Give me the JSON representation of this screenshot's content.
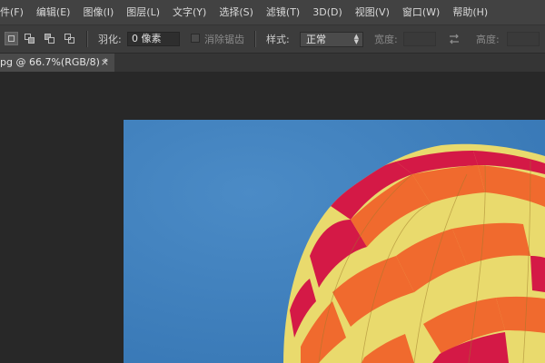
{
  "menubar": {
    "items": [
      {
        "label": "件(F)"
      },
      {
        "label": "编辑(E)"
      },
      {
        "label": "图像(I)"
      },
      {
        "label": "图层(L)"
      },
      {
        "label": "文字(Y)"
      },
      {
        "label": "选择(S)"
      },
      {
        "label": "滤镜(T)"
      },
      {
        "label": "3D(D)"
      },
      {
        "label": "视图(V)"
      },
      {
        "label": "窗口(W)"
      },
      {
        "label": "帮助(H)"
      }
    ]
  },
  "options": {
    "feather_label": "羽化:",
    "feather_value": "0 像素",
    "antialias_label": "消除锯齿",
    "style_label": "样式:",
    "style_value": "正常",
    "width_label": "宽度:",
    "height_label": "高度:"
  },
  "document": {
    "tab_title": "pg @ 66.7%(RGB/8) *",
    "close_glyph": "×"
  },
  "colors": {
    "sky": "#3d7fbd",
    "balloon_yellow": "#e8d96a",
    "balloon_orange": "#f06a2e",
    "balloon_red": "#d01a44"
  }
}
